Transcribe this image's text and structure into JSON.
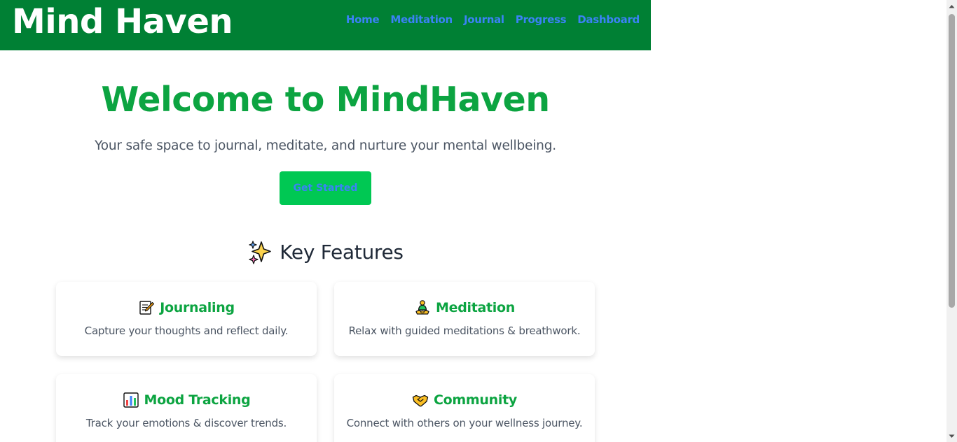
{
  "header": {
    "brand": "Mind Haven",
    "nav": [
      "Home",
      "Meditation",
      "Journal",
      "Progress",
      "Dashboard"
    ]
  },
  "hero": {
    "title": "Welcome to MindHaven",
    "subtitle": "Your safe space to journal, meditate, and nurture your mental wellbeing.",
    "cta_label": "Get Started"
  },
  "features": {
    "heading": "Key Features",
    "heading_icon": "sparkles-icon",
    "cards": [
      {
        "title": "Journaling",
        "description": "Capture your thoughts and reflect daily.",
        "icon": "memo-icon"
      },
      {
        "title": "Meditation",
        "description": "Relax with guided meditations & breathwork.",
        "icon": "meditating-person-icon"
      },
      {
        "title": "Mood Tracking",
        "description": "Track your emotions & discover trends.",
        "icon": "bar-chart-icon"
      },
      {
        "title": "Community",
        "description": "Connect with others on your wellness journey.",
        "icon": "handshake-icon"
      }
    ]
  },
  "colors": {
    "header_bg": "#008034",
    "brand_text": "#ffffff",
    "nav_link": "#3b82f6",
    "accent_green": "#0ca441",
    "cta_bg": "#00c853",
    "body_text": "#4b5563",
    "heading_text": "#1f2937"
  }
}
